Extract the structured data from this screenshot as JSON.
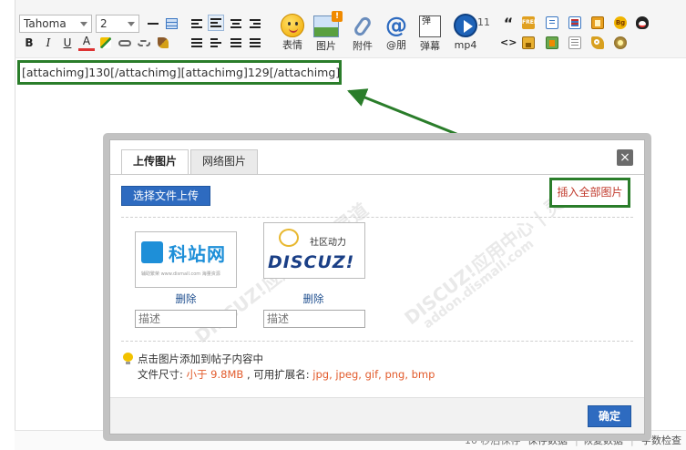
{
  "toolbar": {
    "font_family": "Tahoma",
    "font_size": "2",
    "format_buttons": [
      "B",
      "I",
      "U",
      "A"
    ],
    "big_buttons": [
      {
        "label": "表情",
        "icon": "smiley-icon"
      },
      {
        "label": "图片",
        "icon": "image-icon",
        "badge": "!"
      },
      {
        "label": "附件",
        "icon": "paperclip-icon"
      },
      {
        "label": "@朋",
        "icon": "at-icon"
      },
      {
        "label": "弹幕",
        "icon": "danmaku-icon"
      },
      {
        "label": "mp4",
        "icon": "play-icon"
      }
    ],
    "mp4_counter": "11",
    "quote_glyph": "“",
    "code_glyph": "<>",
    "danmaku_glyph": "弹",
    "free_label": "FREE",
    "bg_label": "Bg"
  },
  "editor": {
    "content": "[attachimg]130[/attachimg][attachimg]129[/attachimg]"
  },
  "statusbar": {
    "autosave": "10 秒后保存",
    "save": "保存数据",
    "restore": "恢复数据",
    "wordcount": "字数检查"
  },
  "dialog": {
    "tab_upload": "上传图片",
    "tab_web": "网络图片",
    "close": "×",
    "upload_button": "选择文件上传",
    "insert_all": "插入全部图片",
    "images": [
      {
        "name": "kezhan-logo",
        "logo_text": "科站网",
        "caption": "辅助繁荣 www.dismall.com 海量资源",
        "delete_label": "删除",
        "desc_placeholder": "描述"
      },
      {
        "name": "discuz-logo",
        "logo_text": "DISCUZ!",
        "logo_sub": "社区动力",
        "delete_label": "删除",
        "desc_placeholder": "描述"
      }
    ],
    "tip_line1": "点击图片添加到帖子内容中",
    "tip_size_prefix": "文件尺寸: ",
    "tip_size_value": "小于 9.8MB",
    "tip_ext_prefix": " , 可用扩展名: ",
    "tip_ext_value": "jpg, jpeg, gif, png, bmp",
    "ok_button": "确定"
  },
  "watermarks": [
    "DISCUZ!应用中心 | 灵道",
    "addon.dismall.com"
  ],
  "colors": {
    "annotation_green": "#2a7d2a",
    "primary_blue": "#2e6bc0",
    "insert_red": "#c0392b",
    "highlight_orange": "#e25b2c"
  }
}
